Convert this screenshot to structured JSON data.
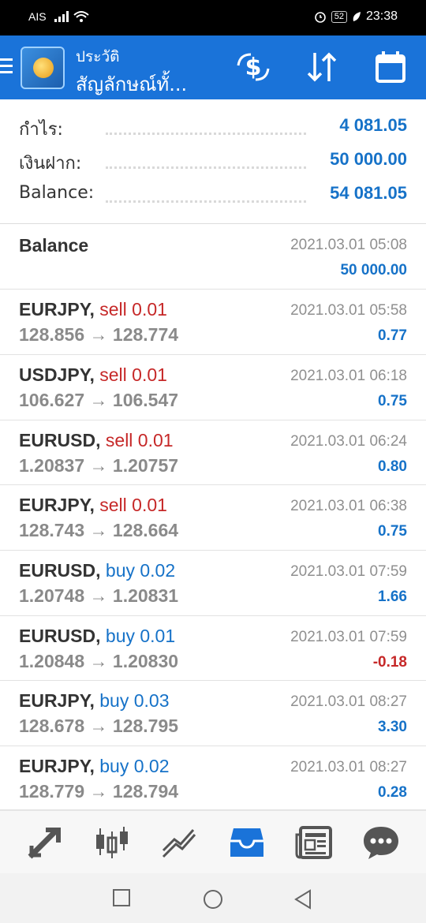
{
  "status_bar": {
    "carrier": "AIS",
    "battery": "52",
    "time": "23:38"
  },
  "header": {
    "subtitle": "ประวัติ",
    "title": "สัญลักษณ์ทั้...",
    "accent": "#1a73d9"
  },
  "summary": [
    {
      "label": "กำไร:",
      "value": "4 081.05"
    },
    {
      "label": "เงินฝาก:",
      "value": "50 000.00"
    },
    {
      "label": "Balance:",
      "value": "54 081.05"
    }
  ],
  "balance_entry": {
    "label": "Balance",
    "date": "2021.03.01 05:08",
    "amount": "50 000.00"
  },
  "trades": [
    {
      "symbol": "EURJPY,",
      "action": "sell 0.01",
      "side": "sell",
      "prices": "128.856 → 128.774",
      "date": "2021.03.01 05:58",
      "profit": "0.77"
    },
    {
      "symbol": "USDJPY,",
      "action": "sell 0.01",
      "side": "sell",
      "prices": "106.627 → 106.547",
      "date": "2021.03.01 06:18",
      "profit": "0.75"
    },
    {
      "symbol": "EURUSD,",
      "action": "sell 0.01",
      "side": "sell",
      "prices": "1.20837 → 1.20757",
      "date": "2021.03.01 06:24",
      "profit": "0.80"
    },
    {
      "symbol": "EURJPY,",
      "action": "sell 0.01",
      "side": "sell",
      "prices": "128.743 → 128.664",
      "date": "2021.03.01 06:38",
      "profit": "0.75"
    },
    {
      "symbol": "EURUSD,",
      "action": "buy 0.02",
      "side": "buy",
      "prices": "1.20748 → 1.20831",
      "date": "2021.03.01 07:59",
      "profit": "1.66"
    },
    {
      "symbol": "EURUSD,",
      "action": "buy 0.01",
      "side": "buy",
      "prices": "1.20848 → 1.20830",
      "date": "2021.03.01 07:59",
      "profit": "-0.18"
    },
    {
      "symbol": "EURJPY,",
      "action": "buy 0.03",
      "side": "buy",
      "prices": "128.678 → 128.795",
      "date": "2021.03.01 08:27",
      "profit": "3.30"
    },
    {
      "symbol": "EURJPY,",
      "action": "buy 0.02",
      "side": "buy",
      "prices": "128.779 → 128.794",
      "date": "2021.03.01 08:27",
      "profit": "0.28"
    }
  ],
  "bottom_nav": [
    {
      "icon": "trade-arrow-icon"
    },
    {
      "icon": "candlestick-chart-icon"
    },
    {
      "icon": "trend-line-icon"
    },
    {
      "icon": "inbox-icon"
    },
    {
      "icon": "news-icon"
    },
    {
      "icon": "chat-icon"
    }
  ]
}
